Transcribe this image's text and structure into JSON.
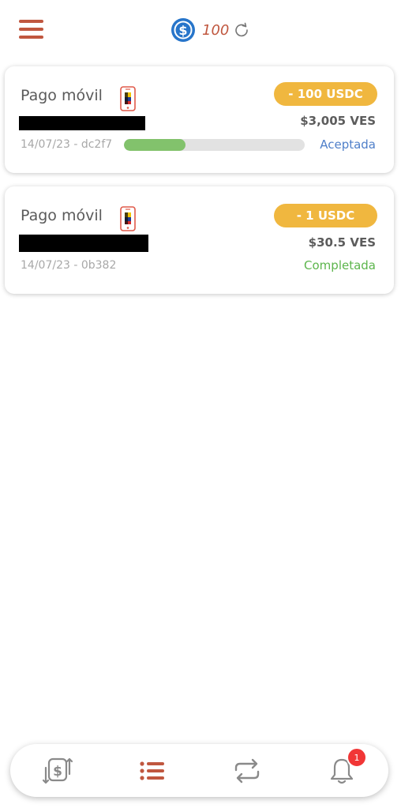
{
  "header": {
    "balance": "100",
    "icons": {
      "menu": "hamburger-menu-icon",
      "coin": "usdc-coin-icon",
      "refresh": "refresh-icon"
    }
  },
  "transactions": [
    {
      "method": "Pago móvil",
      "badge": "- 100 USDC",
      "amount": "$3,005 VES",
      "meta": "14/07/23 - dc2f7",
      "progress": 0.34,
      "status": "Aceptada"
    },
    {
      "method": "Pago móvil",
      "badge": "- 1 USDC",
      "amount": "$30.5 VES",
      "meta": "14/07/23 - 0b382",
      "status": "Completada"
    }
  ],
  "nav": {
    "notifications_count": "1",
    "icons": [
      "exchange-dollar-icon",
      "list-icon",
      "transfer-arrows-icon",
      "bell-icon"
    ]
  },
  "colors": {
    "accent": "#c0573f",
    "badge": "#f0b73f",
    "progress": "#82c26c",
    "accepted": "#4f7fc9",
    "completed": "#5cb54c",
    "notification": "#f13636"
  }
}
